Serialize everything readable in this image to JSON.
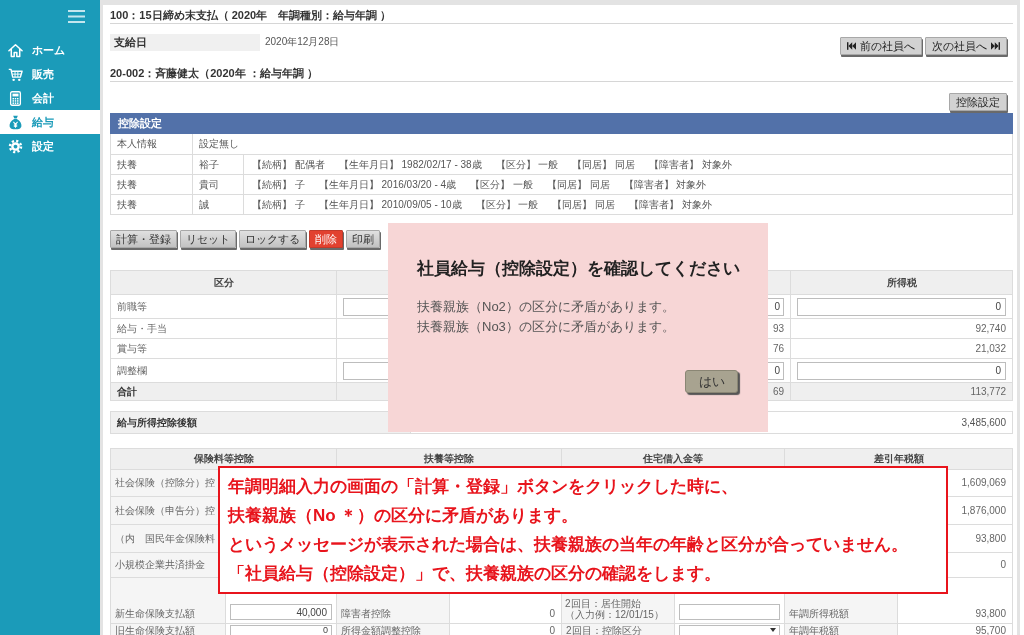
{
  "sidebar": {
    "items": [
      {
        "label": "ホーム",
        "selected": false
      },
      {
        "label": "販売",
        "selected": false
      },
      {
        "label": "会計",
        "selected": false
      },
      {
        "label": "給与",
        "selected": true
      },
      {
        "label": "設定",
        "selected": false
      }
    ]
  },
  "header": {
    "title": "100：15日締め末支払（ 2020年　年調種別：給与年調 ）",
    "pay_date": {
      "label": "支給日",
      "value": "2020年12月28日"
    },
    "nav_buttons": [
      {
        "kind": "previous",
        "label": "前の社員へ"
      },
      {
        "kind": "next",
        "label": "次の社員へ"
      }
    ]
  },
  "employee": {
    "title": "20-002：斉藤健太（2020年 ：給与年調 ）",
    "settings_button": "控除設定"
  },
  "deduction_settings": {
    "title": "控除設定",
    "rows": [
      {
        "kind": "self",
        "type": "本人情報",
        "value": "設定無し"
      },
      {
        "kind": "dependent",
        "type": "扶養",
        "name": "裕子",
        "fields": [
          "【続柄】 配偶者",
          "【生年月日】 1982/02/17 - 38歳",
          "【区分】 一般",
          "【同居】 同居",
          "【障害者】 対象外"
        ]
      },
      {
        "kind": "dependent",
        "type": "扶養",
        "name": "貴司",
        "fields": [
          "【続柄】 子",
          "【生年月日】 2016/03/20 - 4歳",
          "【区分】 一般",
          "【同居】 同居",
          "【障害者】 対象外"
        ]
      },
      {
        "kind": "dependent",
        "type": "扶養",
        "name": "誠",
        "fields": [
          "【続柄】 子",
          "【生年月日】 2010/09/05 - 10歳",
          "【区分】 一般",
          "【同居】 同居",
          "【障害者】 対象外"
        ]
      }
    ]
  },
  "actions": [
    {
      "kind": "normal",
      "label": "計算・登録"
    },
    {
      "kind": "normal",
      "label": "リセット"
    },
    {
      "kind": "normal",
      "label": "ロックする"
    },
    {
      "kind": "danger",
      "label": "削除"
    },
    {
      "kind": "normal",
      "label": "印刷"
    }
  ],
  "income_table": {
    "columns": {
      "column_1": "区分",
      "column_4": "所得税"
    },
    "rows": [
      {
        "kind": "input",
        "label": "前職等",
        "column_3": "0",
        "column_4": "0"
      },
      {
        "kind": "text",
        "label": "給与・手当",
        "column_3": "93",
        "column_4": "92,740"
      },
      {
        "kind": "text",
        "label": "賞与等",
        "column_3": "76",
        "column_4": "21,032"
      },
      {
        "kind": "input",
        "label": "調整欄",
        "column_3": "0",
        "column_4": "0"
      },
      {
        "kind": "total",
        "label": "合計",
        "column_3": "69",
        "column_4": "113,772"
      }
    ]
  },
  "after_deduction": {
    "label": "給与所得控除後額",
    "value": "3,485,600"
  },
  "deductions_table": {
    "headers": [
      "保険料等控除",
      "扶養等控除",
      "住宅借入金等",
      "差引年税額"
    ],
    "rows": [
      {
        "cells": {
          "column_1": {
            "kind": "label",
            "text": "社会保険（控除分）控"
          },
          "column_8": {
            "kind": "value",
            "text": "1,609,069"
          }
        }
      },
      {
        "cells": {
          "column_1": {
            "kind": "label",
            "text": "社会保険（申告分）控"
          },
          "column_8": {
            "kind": "value",
            "text": "1,876,000"
          }
        }
      },
      {
        "cells": {
          "column_1": {
            "kind": "label",
            "text": "（内　国民年金保険料"
          },
          "column_8": {
            "kind": "value",
            "text": "93,800"
          }
        }
      },
      {
        "cells": {
          "column_1": {
            "kind": "label",
            "text": "小規模企業共済掛金"
          },
          "column_8": {
            "kind": "value",
            "text": "0"
          }
        }
      },
      {
        "cells": {
          "column_1": {
            "kind": "label",
            "text": "新生命保険支払額"
          },
          "column_2": {
            "kind": "input",
            "value": "40,000"
          },
          "column_3": {
            "kind": "label",
            "text": "障害者控除"
          },
          "column_4": {
            "kind": "value",
            "text": "0"
          },
          "column_5": {
            "kind": "label",
            "text": "2回目：居住開始",
            "note": "（入力例：12/01/15）"
          },
          "column_6": {
            "kind": "input"
          },
          "column_7": {
            "kind": "label",
            "text": "年調所得税額"
          },
          "column_8": {
            "kind": "value",
            "text": "93,800"
          }
        }
      },
      {
        "cells": {
          "column_1": {
            "kind": "label",
            "text": "旧生命保険支払額"
          },
          "column_2": {
            "kind": "input",
            "value": "0"
          },
          "column_3": {
            "kind": "label",
            "text": "所得金額調整控除"
          },
          "column_4": {
            "kind": "value",
            "text": "0"
          },
          "column_5": {
            "kind": "label",
            "text": "2回目：控除区分"
          },
          "column_6": {
            "kind": "select"
          },
          "column_7": {
            "kind": "label",
            "text": "年調年税額"
          },
          "column_8": {
            "kind": "value",
            "text": "95,700"
          }
        }
      }
    ]
  },
  "dialog": {
    "title": "社員給与（控除設定）を確認してください",
    "messages": [
      "扶養親族（No2）の区分に矛盾があります。",
      "扶養親族（No3）の区分に矛盾があります。"
    ],
    "button": "はい"
  },
  "annotation": {
    "lines": [
      "年調明細入力の画面の「計算・登録」ボタンをクリックした時に、",
      "扶養親族（No ＊）の区分に矛盾があります。",
      "というメッセージが表示された場合は、扶養親族の当年の年齢と区分が合っていません。",
      "「社員給与（控除設定）」で、扶養親族の区分の確認をします。"
    ]
  }
}
